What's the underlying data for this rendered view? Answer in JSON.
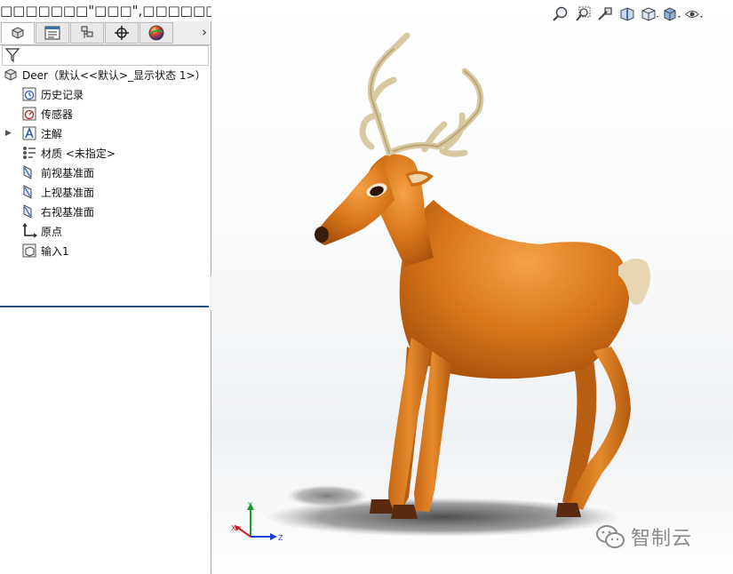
{
  "window": {
    "caption": "□□□□□□□\"□□□\",□□□□□□"
  },
  "feature_manager": {
    "tabs": [
      {
        "name": "feature-manager-tab",
        "icon": "part-tree-icon",
        "active": true
      },
      {
        "name": "property-manager-tab",
        "icon": "property-manager-icon"
      },
      {
        "name": "configuration-manager-tab",
        "icon": "configuration-manager-icon"
      },
      {
        "name": "dimxpert-manager-tab",
        "icon": "crosshair-icon"
      },
      {
        "name": "display-manager-tab",
        "icon": "appearance-sphere-icon"
      }
    ],
    "filter_icon": "funnel-icon",
    "root": {
      "label": "Deer（默认<<默认>_显示状态 1>）",
      "icon": "part-icon"
    },
    "items": [
      {
        "label": "历史记录",
        "icon": "history-icon"
      },
      {
        "label": "传感器",
        "icon": "sensor-icon"
      },
      {
        "label": "注解",
        "icon": "annotation-icon",
        "expandable": true
      },
      {
        "label": "材质 <未指定>",
        "icon": "material-icon"
      },
      {
        "label": "前视基准面",
        "icon": "plane-icon"
      },
      {
        "label": "上视基准面",
        "icon": "plane-icon"
      },
      {
        "label": "右视基准面",
        "icon": "plane-icon"
      },
      {
        "label": "原点",
        "icon": "origin-icon"
      },
      {
        "label": "输入1",
        "icon": "imported-body-icon"
      }
    ]
  },
  "heads_up_toolbar": {
    "buttons": [
      "zoom-to-fit-icon",
      "zoom-to-area-icon",
      "previous-view-icon",
      "section-view-icon",
      "view-orientation-icon",
      "display-style-icon",
      "hide-show-icon"
    ]
  },
  "triad": {
    "axes": [
      "X",
      "Y",
      "Z"
    ],
    "colors": {
      "x": "#d42020",
      "y": "#1a9a2a",
      "z": "#2040d0"
    }
  },
  "model_colors": {
    "body": "#d9761a",
    "antler": "#d8caa0",
    "tail": "#e7d6b2",
    "hoof": "#5a2a10"
  },
  "watermark": {
    "text": "智制云",
    "icon": "wechat-icon"
  }
}
